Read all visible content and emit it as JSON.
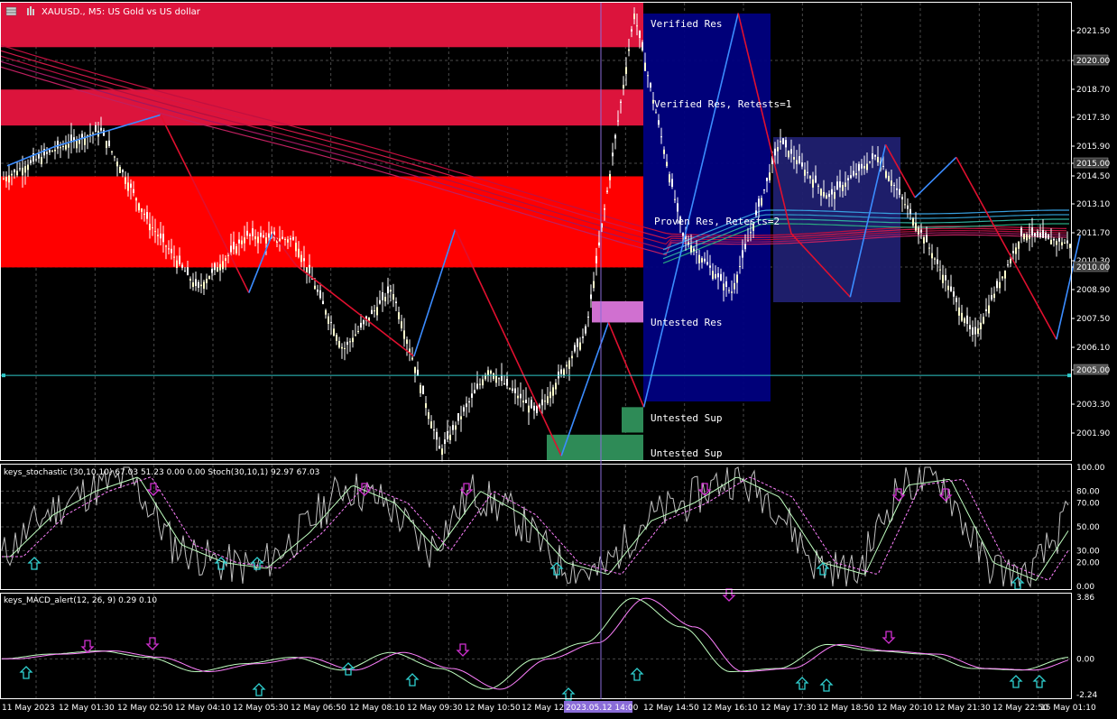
{
  "window": {
    "title": "XAUUSD., M5:  US Gold vs US dollar",
    "icons": [
      "chart-menu-icon",
      "bars-icon"
    ]
  },
  "colors": {
    "background": "#000000",
    "axis": "#ffffff",
    "grid": "#4a4a4a",
    "bull_candle": "#ffffcc",
    "bear_candle": "#ffffff",
    "zigzag_up": "#3b8cff",
    "zigzag_down": "#e0102f",
    "resistance_zone_strong": "#ff0000",
    "resistance_zone_verified": "#dc143c",
    "untested_res_zone": "#d070d0",
    "untested_sup_zone": "#2e8b57",
    "highlight_box": "#000080",
    "highlight_box2": "#1a1a66",
    "hline": "#2fc8c8",
    "stoch_main": "#c0c0c0",
    "stoch_signal": "#c0ffc0",
    "stoch_dashed": "#ff80ff",
    "macd_main": "#c0ffc0",
    "macd_signal": "#ff80ff",
    "arrow_up": "#2fd0d0",
    "arrow_down": "#d030d0"
  },
  "price_axis": {
    "labels": [
      "2021.50",
      "2020.00",
      "2018.70",
      "2017.30",
      "2015.90",
      "2015.00",
      "2014.50",
      "2013.10",
      "2011.70",
      "2010.30",
      "2010.00",
      "2008.90",
      "2007.50",
      "2006.10",
      "2005.00",
      "2003.30",
      "2001.90"
    ],
    "highlighted": [
      "2020.00",
      "2015.00",
      "2010.00",
      "2005.00"
    ],
    "range": [
      2001.0,
      2022.6
    ]
  },
  "zones": [
    {
      "label": "Verified Res",
      "low": 2020.5,
      "high": 2022.6
    },
    {
      "label": "Verified Res, Retests=1",
      "low": 2016.8,
      "high": 2018.5
    },
    {
      "label": "Proven Res, Retests=2",
      "low": 2010.1,
      "high": 2014.4
    },
    {
      "label": "Untested Res",
      "low": 2007.5,
      "high": 2008.5
    },
    {
      "label": "Untested Sup",
      "low": 2002.3,
      "high": 2003.5
    },
    {
      "label": "Untested Sup",
      "low": 2001.0,
      "high": 2002.2
    }
  ],
  "time_axis": {
    "labels": [
      "11 May 2023",
      "12 May 01:30",
      "12 May 02:50",
      "12 May 04:10",
      "12 May 05:30",
      "12 May 06:50",
      "12 May 08:10",
      "12 May 09:30",
      "12 May 10:50",
      "12 May 12:",
      "2023.05.12 14:00",
      "12 May 14:50",
      "12 May 16:10",
      "12 May 17:30",
      "12 May 18:50",
      "12 May 20:10",
      "12 May 21:30",
      "12 May 22:50",
      "15 May 01:10"
    ],
    "cursor_label": "2023.05.12 14:00"
  },
  "stochastic": {
    "title": "keys_stochastic (30,10,10) 67.03 51.23 0.00 0.00  Stoch(30,10,1) 92.97 67.03",
    "levels": [
      "100.00",
      "80.00",
      "70.00",
      "50.00",
      "30.00",
      "20.00",
      "0.00"
    ]
  },
  "macd": {
    "title": "keys_MACD_alert(12, 26, 9) 0.29 0.10",
    "levels": [
      "3.86",
      "0.00",
      "-2.24"
    ]
  },
  "chart_data": {
    "type": "line",
    "title": "XAUUSD., M5:  US Gold vs US dollar",
    "xlabel": "",
    "ylabel": "",
    "ylim": [
      2001.0,
      2022.6
    ],
    "x": [
      "11 May 2023",
      "12 May 01:30",
      "12 May 02:50",
      "12 May 04:10",
      "12 May 05:30",
      "12 May 06:50",
      "12 May 08:10",
      "12 May 09:30",
      "12 May 10:50",
      "12 May 12:",
      "2023.05.12 14:00",
      "12 May 14:50",
      "12 May 16:10",
      "12 May 17:30",
      "12 May 18:50",
      "12 May 20:10",
      "12 May 21:30",
      "12 May 22:50",
      "15 May 01:10"
    ],
    "series": [
      {
        "values": [
          2014.3,
          2015.6,
          2016.6,
          2012.2,
          2009.1,
          2011.6,
          2011.4,
          2006.2,
          2009.1,
          2001.4,
          2005.3,
          2003.2,
          2007.0,
          2022.1,
          2011.6,
          2008.9,
          2016.1,
          2013.4,
          2015.4,
          2011.4,
          2006.8,
          2011.7,
          2011.2
        ]
      }
    ],
    "zigzag": [
      {
        "t": 0.0,
        "p": 2014.9
      },
      {
        "t": 0.8,
        "p": 2015.8
      },
      {
        "t": 2.6,
        "p": 2017.3
      },
      {
        "t": 4.1,
        "p": 2008.9
      },
      {
        "t": 4.5,
        "p": 2011.7
      },
      {
        "t": 4.9,
        "p": 2010.2
      },
      {
        "t": 6.9,
        "p": 2005.9
      },
      {
        "t": 7.6,
        "p": 2011.9
      },
      {
        "t": 9.4,
        "p": 2001.2
      },
      {
        "t": 10.2,
        "p": 2007.5
      },
      {
        "t": 10.8,
        "p": 2003.5
      },
      {
        "t": 12.4,
        "p": 2022.1
      },
      {
        "t": 13.3,
        "p": 2011.7
      },
      {
        "t": 14.3,
        "p": 2008.7
      },
      {
        "t": 14.9,
        "p": 2015.9
      },
      {
        "t": 15.4,
        "p": 2013.4
      },
      {
        "t": 16.1,
        "p": 2015.3
      },
      {
        "t": 17.8,
        "p": 2006.7
      },
      {
        "t": 18.2,
        "p": 2011.6
      }
    ],
    "stochastic_values": [
      25,
      60,
      80,
      92,
      35,
      20,
      15,
      45,
      85,
      70,
      30,
      80,
      60,
      20,
      10,
      55,
      70,
      92,
      75,
      20,
      10,
      85,
      90,
      20,
      5,
      60
    ],
    "macd_values": [
      0.0,
      0.3,
      0.5,
      0.1,
      -0.8,
      -0.3,
      0.1,
      -0.7,
      0.4,
      -0.6,
      -1.9,
      0.0,
      1.0,
      3.8,
      2.0,
      -0.8,
      -0.6,
      0.9,
      0.5,
      0.3,
      -0.6,
      -0.7,
      0.1
    ]
  }
}
